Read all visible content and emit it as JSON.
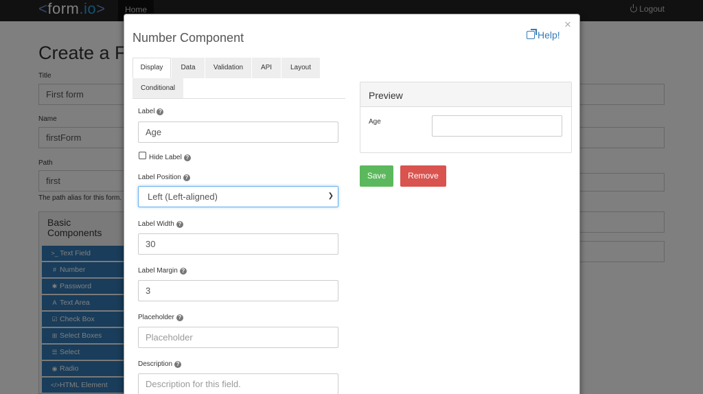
{
  "navbar": {
    "brand_lt": "<",
    "brand_form": "form",
    "brand_dot": ".",
    "brand_io": "io",
    "brand_gt": ">",
    "home": "Home",
    "logout": "Logout"
  },
  "page": {
    "title": "Create a Form",
    "fields": {
      "title_label": "Title",
      "title_value": "First form",
      "name_label": "Name",
      "name_value": "firstForm",
      "path_label": "Path",
      "path_value": "first",
      "path_help": "The path alias for this form."
    },
    "sidebar": {
      "title": "Basic Components",
      "items": [
        {
          "icon": ">_",
          "label": "Text Field"
        },
        {
          "icon": "#",
          "label": "Number"
        },
        {
          "icon": "✱",
          "label": "Password"
        },
        {
          "icon": "A",
          "label": "Text Area"
        },
        {
          "icon": "☑",
          "label": "Check Box"
        },
        {
          "icon": "⊞",
          "label": "Select Boxes"
        },
        {
          "icon": "☰",
          "label": "Select"
        },
        {
          "icon": "◉",
          "label": "Radio"
        },
        {
          "icon": "</>",
          "label": "HTML Element"
        }
      ]
    }
  },
  "modal": {
    "title": "Number Component",
    "help": "Help!",
    "close": "×",
    "tabs": [
      "Display",
      "Data",
      "Validation",
      "API",
      "Layout",
      "Conditional"
    ],
    "active_tab": "Display",
    "form": {
      "label_label": "Label",
      "label_value": "Age",
      "hide_label": "Hide Label",
      "hide_label_checked": false,
      "label_position_label": "Label Position",
      "label_position_value": "Left (Left-aligned)",
      "label_width_label": "Label Width",
      "label_width_value": "30",
      "label_margin_label": "Label Margin",
      "label_margin_value": "3",
      "placeholder_label": "Placeholder",
      "placeholder_placeholder": "Placeholder",
      "description_label": "Description",
      "description_placeholder": "Description for this field."
    },
    "preview": {
      "title": "Preview",
      "field_label": "Age"
    },
    "buttons": {
      "save": "Save",
      "remove": "Remove"
    }
  },
  "colors": {
    "primary": "#337ab7",
    "save": "#5cb85c",
    "remove": "#d9534f",
    "navbar": "#222222"
  }
}
